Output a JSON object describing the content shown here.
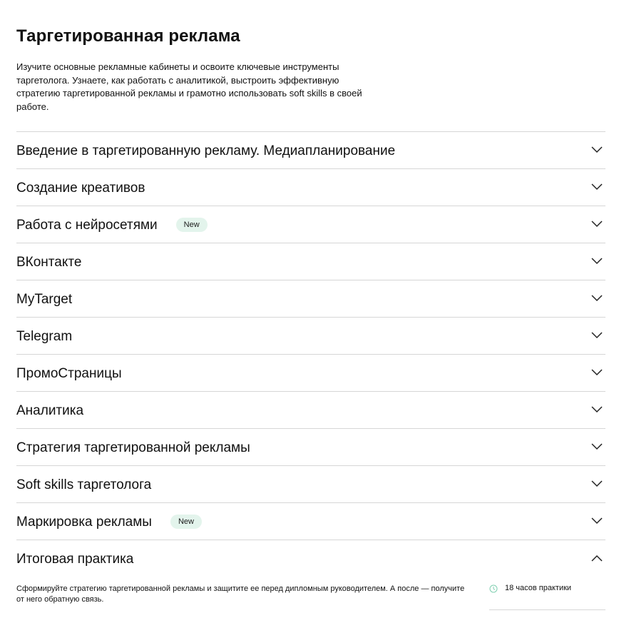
{
  "page": {
    "title": "Таргетированная реклама",
    "intro": "Изучите основные рекламные кабинеты и освоите ключевые инструменты таргетолога. Узнаете, как работать с аналитикой, выстроить эффективную стратегию таргетированной рекламы и грамотно использовать soft skills в своей работе."
  },
  "modules": [
    {
      "label": "Введение в таргетированную рекламу. Медиапланирование",
      "badge": "",
      "expanded": false
    },
    {
      "label": "Создание креативов",
      "badge": "",
      "expanded": false
    },
    {
      "label": "Работа с нейросетями",
      "badge": "New",
      "expanded": false
    },
    {
      "label": "ВКонтакте",
      "badge": "",
      "expanded": false
    },
    {
      "label": "MyTarget",
      "badge": "",
      "expanded": false
    },
    {
      "label": "Telegram",
      "badge": "",
      "expanded": false
    },
    {
      "label": "ПромоСтраницы",
      "badge": "",
      "expanded": false
    },
    {
      "label": "Аналитика",
      "badge": "",
      "expanded": false
    },
    {
      "label": "Стратегия таргетированной рекламы",
      "badge": "",
      "expanded": false
    },
    {
      "label": "Soft skills таргетолога",
      "badge": "",
      "expanded": false
    },
    {
      "label": "Маркировка рекламы",
      "badge": "New",
      "expanded": false
    },
    {
      "label": "Итоговая практика",
      "badge": "",
      "expanded": true
    }
  ],
  "final_module": {
    "description": "Сформируйте стратегию таргетированной рекламы и защитите ее перед дипломным руководителем. А после — получите от него обратную связь.",
    "meta_icon": "clock-icon",
    "meta_text": "18 часов практики"
  },
  "colors": {
    "badge_bg": "#e3f4ec",
    "divider": "#d6d6d6",
    "accent_icon": "#7fcfb0"
  }
}
